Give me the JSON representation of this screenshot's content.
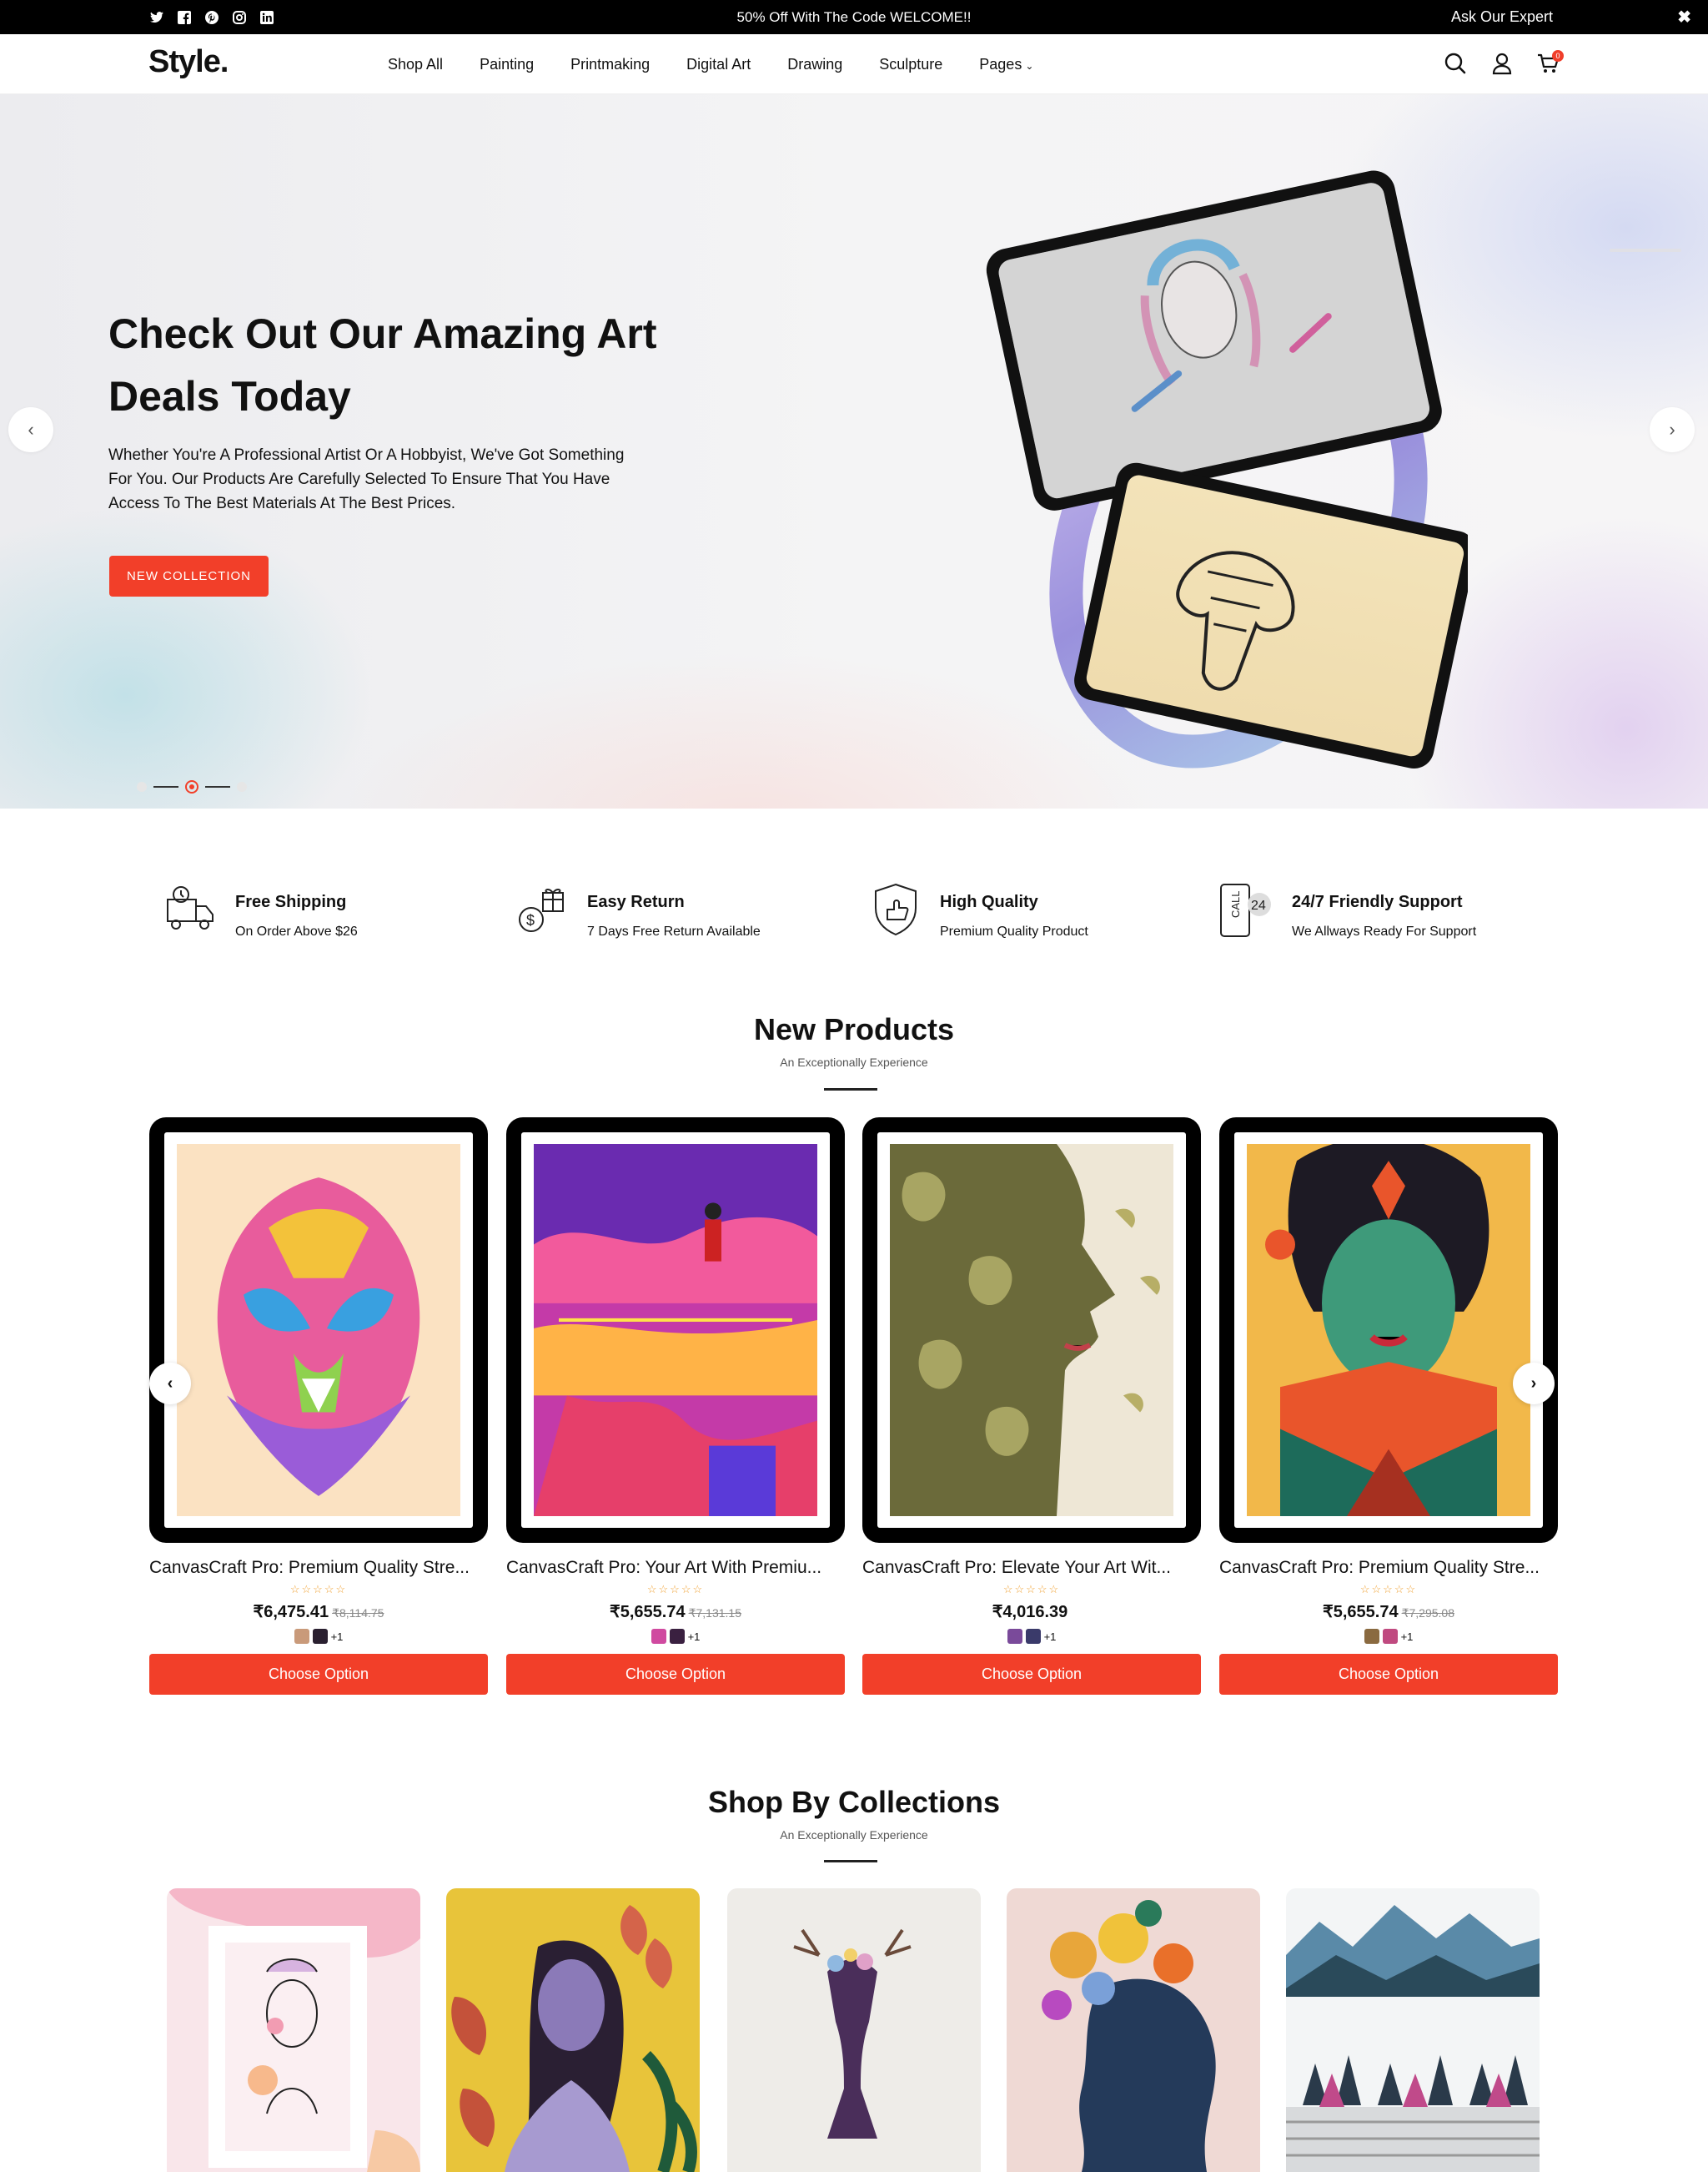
{
  "topbar": {
    "socials": [
      "twitter-icon",
      "facebook-icon",
      "pinterest-icon",
      "instagram-icon",
      "linkedin-icon"
    ],
    "promo": "50% Off With The Code WELCOME!!",
    "expert": "Ask Our Expert",
    "close": "✖"
  },
  "header": {
    "logo": "Style.",
    "nav": [
      "Shop All",
      "Painting",
      "Printmaking",
      "Digital Art",
      "Drawing",
      "Sculpture",
      "Pages"
    ],
    "cart_count": "0"
  },
  "hero": {
    "title": "Check Out Our Amazing Art Deals Today",
    "text": "Whether You're A Professional Artist Or A Hobbyist, We've Got Something For You. Our Products Are Carefully Selected To Ensure That You Have Access To The Best Materials At The Best Prices.",
    "cta": "NEW COLLECTION",
    "prev": "‹",
    "next": "›"
  },
  "features": [
    {
      "title": "Free Shipping",
      "sub": "On Order Above $26",
      "icon": "delivery-truck-icon"
    },
    {
      "title": "Easy Return",
      "sub": "7 Days Free Return Available",
      "icon": "gift-coin-icon"
    },
    {
      "title": "High Quality",
      "sub": "Premium Quality Product",
      "icon": "quality-shield-icon"
    },
    {
      "title": "24/7 Friendly Support",
      "sub": "We Allways Ready For Support",
      "icon": "support-phone-icon"
    }
  ],
  "new_products": {
    "title": "New Products",
    "subtitle": "An Exceptionally Experience",
    "items": [
      {
        "name": "CanvasCraft Pro: Premium Quality Stre...",
        "stars": "☆☆☆☆☆",
        "price": "₹6,475.41",
        "old_price": "₹8,114.75",
        "more": "+1",
        "button": "Choose Option"
      },
      {
        "name": "CanvasCraft Pro: Your Art With Premiu...",
        "stars": "☆☆☆☆☆",
        "price": "₹5,655.74",
        "old_price": "₹7,131.15",
        "more": "+1",
        "button": "Choose Option"
      },
      {
        "name": "CanvasCraft Pro: Elevate Your Art Wit...",
        "stars": "☆☆☆☆☆",
        "price": "₹4,016.39",
        "old_price": "",
        "more": "+1",
        "button": "Choose Option"
      },
      {
        "name": "CanvasCraft Pro: Premium Quality Stre...",
        "stars": "☆☆☆☆☆",
        "price": "₹5,655.74",
        "old_price": "₹7,295.08",
        "more": "+1",
        "button": "Choose Option"
      }
    ],
    "prev": "‹",
    "next": "›"
  },
  "collections": {
    "title": "Shop By Collections",
    "subtitle": "An Exceptionally Experience"
  },
  "colors": {
    "accent": "#f23f29",
    "topbar": "#000000"
  }
}
